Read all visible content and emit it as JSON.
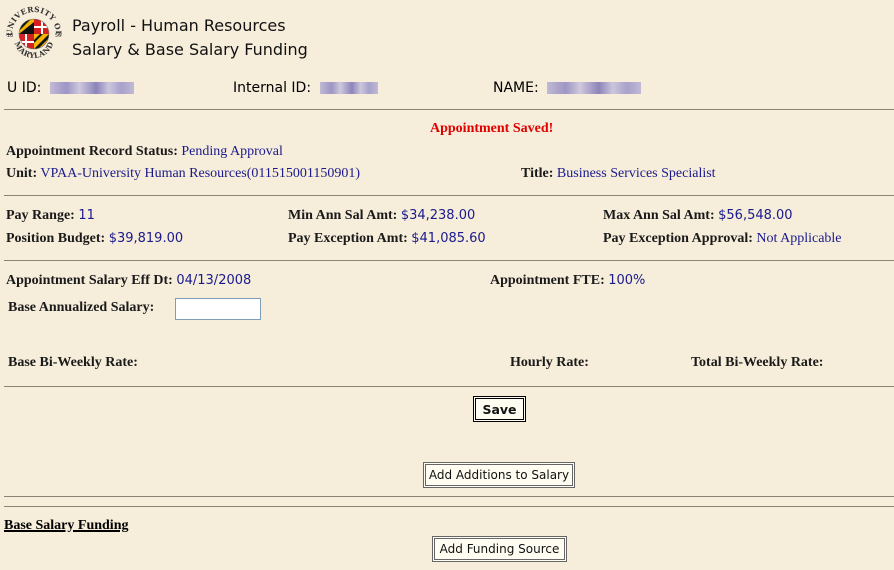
{
  "header": {
    "logo": "university-of-maryland-seal",
    "logo_text": [
      "UNIVERSITY OF",
      "18",
      "56",
      "MARYLAND"
    ],
    "title_line1": "Payroll - Human Resources",
    "title_line2": "Salary & Base Salary Funding"
  },
  "identity": {
    "uid_label": "U ID:",
    "uid_value": "(redacted)",
    "internal_id_label": "Internal ID:",
    "internal_id_value": "(redacted)",
    "name_label": "NAME:",
    "name_value": "(redacted)"
  },
  "status_message": "Appointment Saved!",
  "appointment": {
    "record_status_label": "Appointment Record Status:",
    "record_status_value": "Pending Approval",
    "unit_label": "Unit:",
    "unit_value": "VPAA-University Human Resources(011515001150901)",
    "title_label": "Title:",
    "title_value": "Business Services Specialist"
  },
  "pay": {
    "pay_range_label": "Pay Range:",
    "pay_range_value": "11",
    "min_label": "Min Ann Sal Amt:",
    "min_value": "$34,238.00",
    "max_label": "Max Ann Sal Amt:",
    "max_value": "$56,548.00",
    "position_budget_label": "Position Budget:",
    "position_budget_value": "$39,819.00",
    "pay_exception_amt_label": "Pay Exception Amt:",
    "pay_exception_amt_value": "$41,085.60",
    "pay_exception_approval_label": "Pay Exception Approval:",
    "pay_exception_approval_value": "Not Applicable"
  },
  "salary": {
    "eff_dt_label": "Appointment Salary Eff Dt:",
    "eff_dt_value": "04/13/2008",
    "fte_label": "Appointment FTE:",
    "fte_value": "100%",
    "base_annualized_label": "Base Annualized Salary:",
    "base_annualized_value": "",
    "base_biweekly_label": "Base Bi-Weekly Rate:",
    "hourly_rate_label": "Hourly Rate:",
    "total_biweekly_label": "Total Bi-Weekly Rate:"
  },
  "buttons": {
    "save": "Save",
    "add_additions": "Add Additions to Salary",
    "add_funding": "Add Funding Source"
  },
  "funding": {
    "section_title": "Base Salary Funding"
  }
}
